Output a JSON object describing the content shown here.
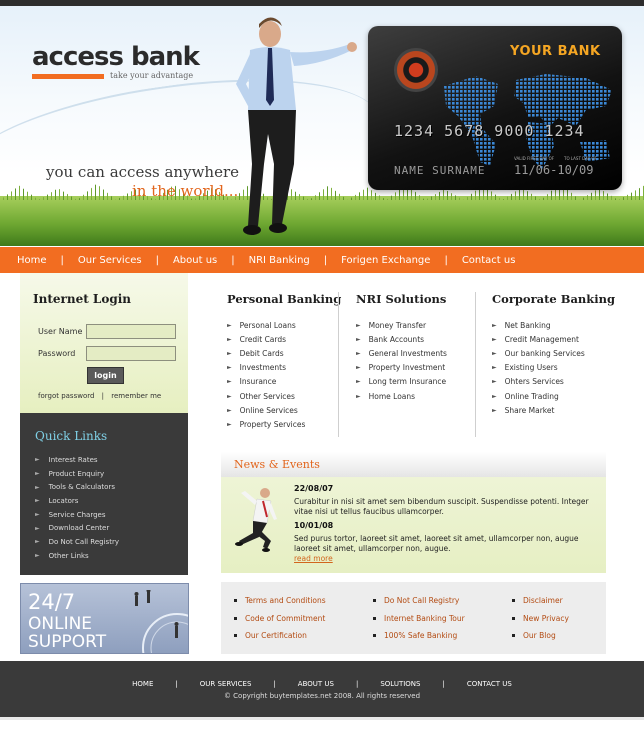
{
  "brand": {
    "name": "access bank",
    "tagline": "take your advantage",
    "accent": "#f26d21"
  },
  "hero": {
    "slogan_line1": "you can access anywhere",
    "slogan_line2": "in the world...",
    "card": {
      "brand": "YOUR BANK",
      "number": "1234 5678 9000 1234",
      "holder": "NAME SURNAME",
      "valid_label_from": "VALID FIRST DAY OF",
      "valid_label_to": "TO LAST DAY OF",
      "dates": "11/06-10/09"
    }
  },
  "nav": [
    "Home",
    "Our Services",
    "About us",
    "NRI Banking",
    "Forigen Exchange",
    "Contact us"
  ],
  "login": {
    "title": "Internet Login",
    "username_label": "User Name",
    "password_label": "Password",
    "button": "login",
    "forgot": "forgot password",
    "separator": "|",
    "remember": "remember me"
  },
  "quick_links": {
    "title": "Quick Links",
    "items": [
      "Interest Rates",
      "Product Enquiry",
      "Tools & Calculators",
      "Locators",
      "Service Charges",
      "Download Center",
      "Do Not Call Registry",
      "Other Links"
    ]
  },
  "support": {
    "line1": "24/7",
    "line2": "ONLINE",
    "line3": "SUPPORT"
  },
  "columns": [
    {
      "title": "Personal Banking",
      "items": [
        "Personal Loans",
        "Credit Cards",
        "Debit Cards",
        "Investments",
        "Insurance",
        "Other Services",
        "Online Services",
        "Property Services"
      ]
    },
    {
      "title": "NRI Solutions",
      "items": [
        "Money Transfer",
        "Bank Accounts",
        "General Investments",
        "Property Investment",
        "Long term Insurance",
        "Home Loans"
      ]
    },
    {
      "title": "Corporate Banking",
      "items": [
        "Net Banking",
        "Credit Management",
        "Our banking Services",
        "Existing Users",
        "Ohters Services",
        "Online Trading",
        "Share Market"
      ]
    }
  ],
  "news": {
    "title": "News & Events",
    "items": [
      {
        "date": "22/08/07",
        "text": "Curabitur in nisi sit amet sem bibendum suscipit. Suspendisse potenti. Integer vitae nisi ut tellus faucibus ullamcorper."
      },
      {
        "date": "10/01/08",
        "text": "Sed purus tortor, laoreet sit amet, laoreet sit amet, ullamcorper non, augue laoreet sit amet, ullamcorper non, augue."
      }
    ],
    "read_more": "read more"
  },
  "quick_footer_links": [
    [
      "Terms and Conditions",
      "Do Not Call Registry",
      "Disclaimer"
    ],
    [
      "Code of Commitment",
      "Internet Banking Tour",
      "New Privacy"
    ],
    [
      "Our Certification",
      "100% Safe Banking",
      "Our Blog"
    ]
  ],
  "footer": {
    "nav": [
      "HOME",
      "OUR SERVICES",
      "ABOUT US",
      "SOLUTIONS",
      "CONTACT US"
    ],
    "separator": "|",
    "copyright": "© Copyright buytemplates.net 2008. All rights reserved"
  }
}
